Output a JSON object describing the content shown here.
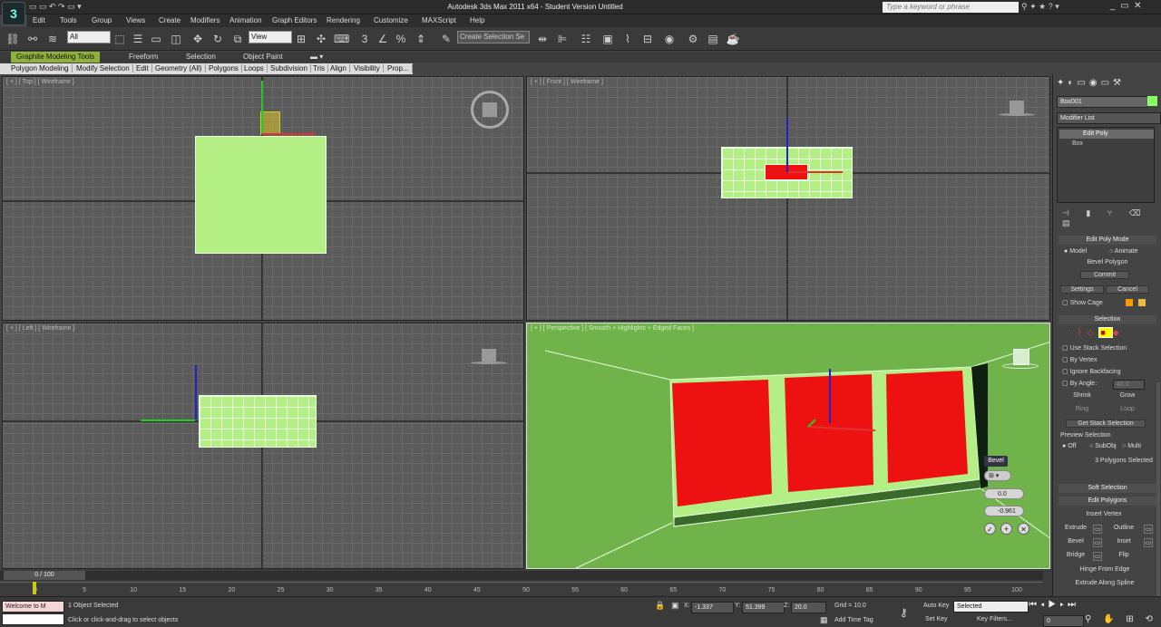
{
  "app": {
    "title": "Autodesk 3ds Max  2011 x64  -  Student Version   Untitled",
    "logo": "3"
  },
  "menu": [
    "Edit",
    "Tools",
    "Group",
    "Views",
    "Create",
    "Modifiers",
    "Animation",
    "Graph Editors",
    "Rendering",
    "Customize",
    "MAXScript",
    "Help"
  ],
  "search_placeholder": "Type a keyword or phrase",
  "toolbar": {
    "filter_value": "All",
    "refcoord_value": "View",
    "named_selection": "Create Selection Se"
  },
  "ribbon": {
    "tabs": [
      "Graphite Modeling Tools",
      "Freeform",
      "Selection",
      "Object Paint"
    ],
    "panels": [
      "Polygon Modeling",
      "Modify Selection",
      "Edit",
      "Geometry (All)",
      "Polygons",
      "Loops",
      "Subdivision",
      "Tris",
      "Align",
      "Visibility",
      "Prop..."
    ]
  },
  "viewports": {
    "top": "[ + ] [ Top ] [ Wireframe ]",
    "front": "[ + ] [ Front ] [ Wireframe ]",
    "left": "[ + ] [ Left ] [ Wireframe ]",
    "perspective": "[ + ] [ Perspective ] [ Smooth + Highlights + Edged Faces ]"
  },
  "caddy": {
    "title": "Bevel",
    "height": "0.0",
    "outline": "-0.961"
  },
  "command_panel": {
    "object_name": "Box001",
    "modifier_list": "Modifier List",
    "stack": [
      "Edit Poly",
      "Box"
    ],
    "edit_poly_mode": {
      "title": "Edit Poly Mode",
      "model": "Model",
      "animate": "Animate",
      "operation": "Bevel Polygon",
      "commit": "Commit",
      "settings": "Settings",
      "cancel": "Cancel",
      "show_cage": "Show Cage"
    },
    "selection": {
      "title": "Selection",
      "use_stack": "Use Stack Selection",
      "by_vertex": "By Vertex",
      "ignore_backfacing": "Ignore Backfacing",
      "by_angle": "By Angle:",
      "by_angle_value": "45.0",
      "shrink": "Shrink",
      "grow": "Grow",
      "ring": "Ring",
      "loop": "Loop",
      "get_stack": "Get Stack Selection",
      "preview": "Preview Selection",
      "off": "Off",
      "subobj": "SubObj",
      "multi": "Multi",
      "status": "3 Polygons Selected"
    },
    "soft_selection": "Soft Selection",
    "edit_polygons": {
      "title": "Edit Polygons",
      "insert_vertex": "Insert Vertex",
      "extrude": "Extrude",
      "outline": "Outline",
      "bevel": "Bevel",
      "inset": "Inset",
      "bridge": "Bridge",
      "flip": "Flip",
      "hinge": "Hinge From Edge",
      "extrude_spline": "Extrude Along Spline"
    }
  },
  "timeline": {
    "frame": "0 / 100",
    "ticks": [
      "0",
      "5",
      "10",
      "15",
      "20",
      "25",
      "30",
      "35",
      "40",
      "45",
      "50",
      "55",
      "60",
      "65",
      "70",
      "75",
      "80",
      "85",
      "90",
      "95",
      "100"
    ]
  },
  "status": {
    "maxscript": "Welcome to M",
    "objects": "1 Object Selected",
    "prompt": "Click or click-and-drag to select objects",
    "x_label": "X:",
    "x": "-1.337",
    "y_label": "Y:",
    "y": "51.399",
    "z_label": "Z:",
    "z": "20.0",
    "grid": "Grid = 10.0",
    "add_time_tag": "Add Time Tag",
    "auto_key": "Auto Key",
    "selected": "Selected",
    "set_key": "Set Key",
    "key_filters": "Key Filters...",
    "frame_field": "0"
  }
}
